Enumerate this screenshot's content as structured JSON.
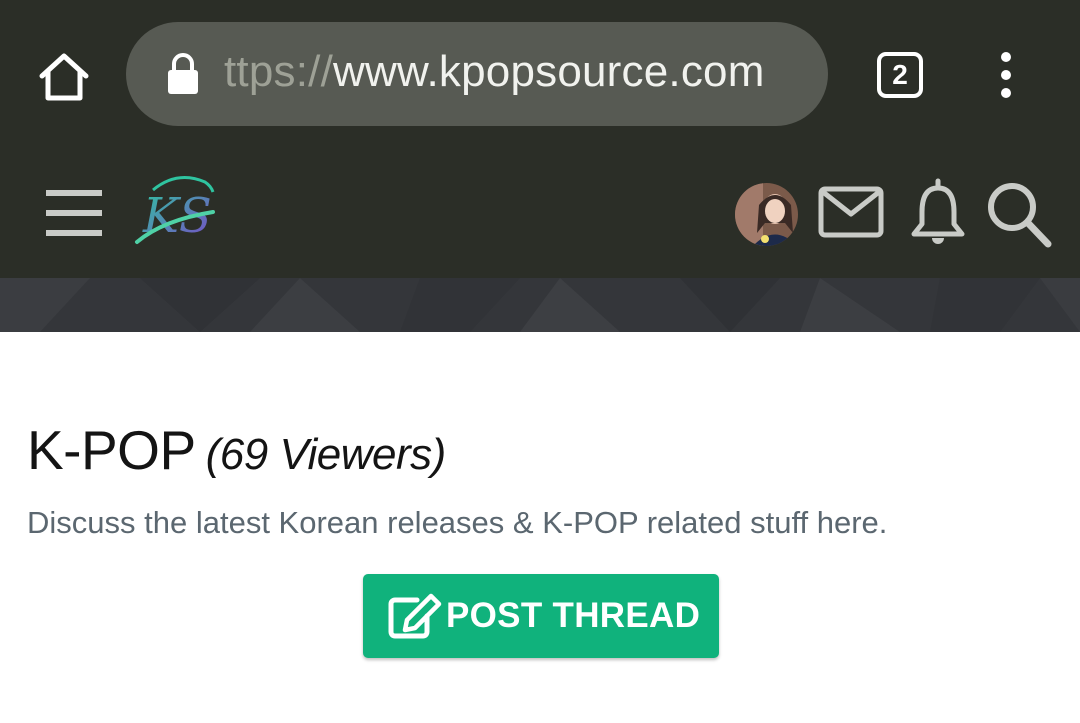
{
  "browser": {
    "url_scheme_fragment": "ttps://",
    "url_host": "www.kpopsource.com",
    "tab_count": "2",
    "icons": [
      "home-icon",
      "lock-icon",
      "tabs-icon",
      "more-vert-icon"
    ]
  },
  "site_header": {
    "icons": [
      "hamburger-menu-icon",
      "site-logo",
      "avatar",
      "mail-icon",
      "bell-icon",
      "search-icon"
    ]
  },
  "forum": {
    "title": "K-POP",
    "viewers": "(69 Viewers)",
    "description": "Discuss the latest Korean releases & K-POP related stuff here.",
    "post_button_label": "POST THREAD"
  },
  "colors": {
    "toolbar_bg": "#2b2e27",
    "url_pill_bg": "#575a53",
    "pattern_bg": "#34363a",
    "accent_green": "#10b27c",
    "title_text": "#141414",
    "desc_text": "#5b6770"
  }
}
